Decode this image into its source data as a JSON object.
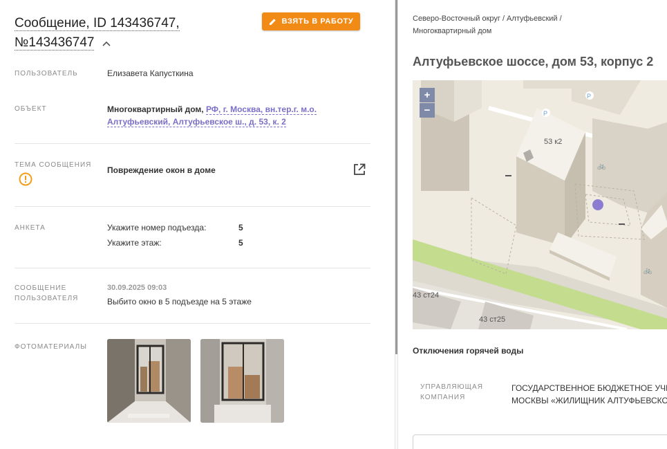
{
  "message": {
    "title_line1": "Сообщение, ID 143436747,",
    "title_line2": "№143436747",
    "take_button": "ВЗЯТЬ В РАБОТУ"
  },
  "fields": {
    "user_label": "ПОЛЬЗОВАТЕЛЬ",
    "user_value": "Елизавета Капусткина",
    "object_label": "ОБЪЕКТ",
    "object_type": "Многоквартирный дом,",
    "object_address_line1": "РФ, г. Москва, вн.тер.г. м.о.",
    "object_address_line2": "Алтуфьевский, Алтуфьевское ш., д. 53, к. 2",
    "topic_label": "ТЕМА СООБЩЕНИЯ",
    "topic_value": "Повреждение окон в доме",
    "survey_label": "АНКЕТА",
    "survey": [
      {
        "question": "Укажите номер подъезда:",
        "answer": "5"
      },
      {
        "question": "Укажите этаж:",
        "answer": "5"
      }
    ],
    "user_message_label_line1": "СООБЩЕНИЕ",
    "user_message_label_line2": "ПОЛЬЗОВАТЕЛЯ",
    "user_message_date": "30.09.2025 09:03",
    "user_message_text": "Выбито окно в 5 подъезде на 5 этаже",
    "photos_label": "ФОТОМАТЕРИАЛЫ"
  },
  "right": {
    "breadcrumb_line1": "Северо-Восточный округ / Алтуфьевский /",
    "breadcrumb_line2": "Многоквартирный дом",
    "address": "Алтуфьевское шоссе, дом 53, корпус 2",
    "map": {
      "zoom_in": "+",
      "zoom_out": "−",
      "building_label": "53 к2",
      "label_a": "43 ст24",
      "label_b": "43 ст25",
      "parking": "P"
    },
    "hot_water": "Отключения горячей воды",
    "mc_label_line1": "УПРАВЛЯЮЩАЯ",
    "mc_label_line2": "КОМПАНИЯ",
    "mc_value_line1": "ГОСУДАРСТВЕННОЕ БЮДЖЕТНОЕ УЧРЕЖДЕНИЕ",
    "mc_value_line2": "МОСКВЫ «ЖИЛИЩНИК АЛТУФЬЕВСКОГО РАЙОНА»"
  },
  "colors": {
    "accent_orange": "#f28a16",
    "link_purple": "#7a6fc8",
    "map_bg": "#efebe0",
    "map_building": "#e2ddd0",
    "map_green": "#c3dc8e"
  }
}
